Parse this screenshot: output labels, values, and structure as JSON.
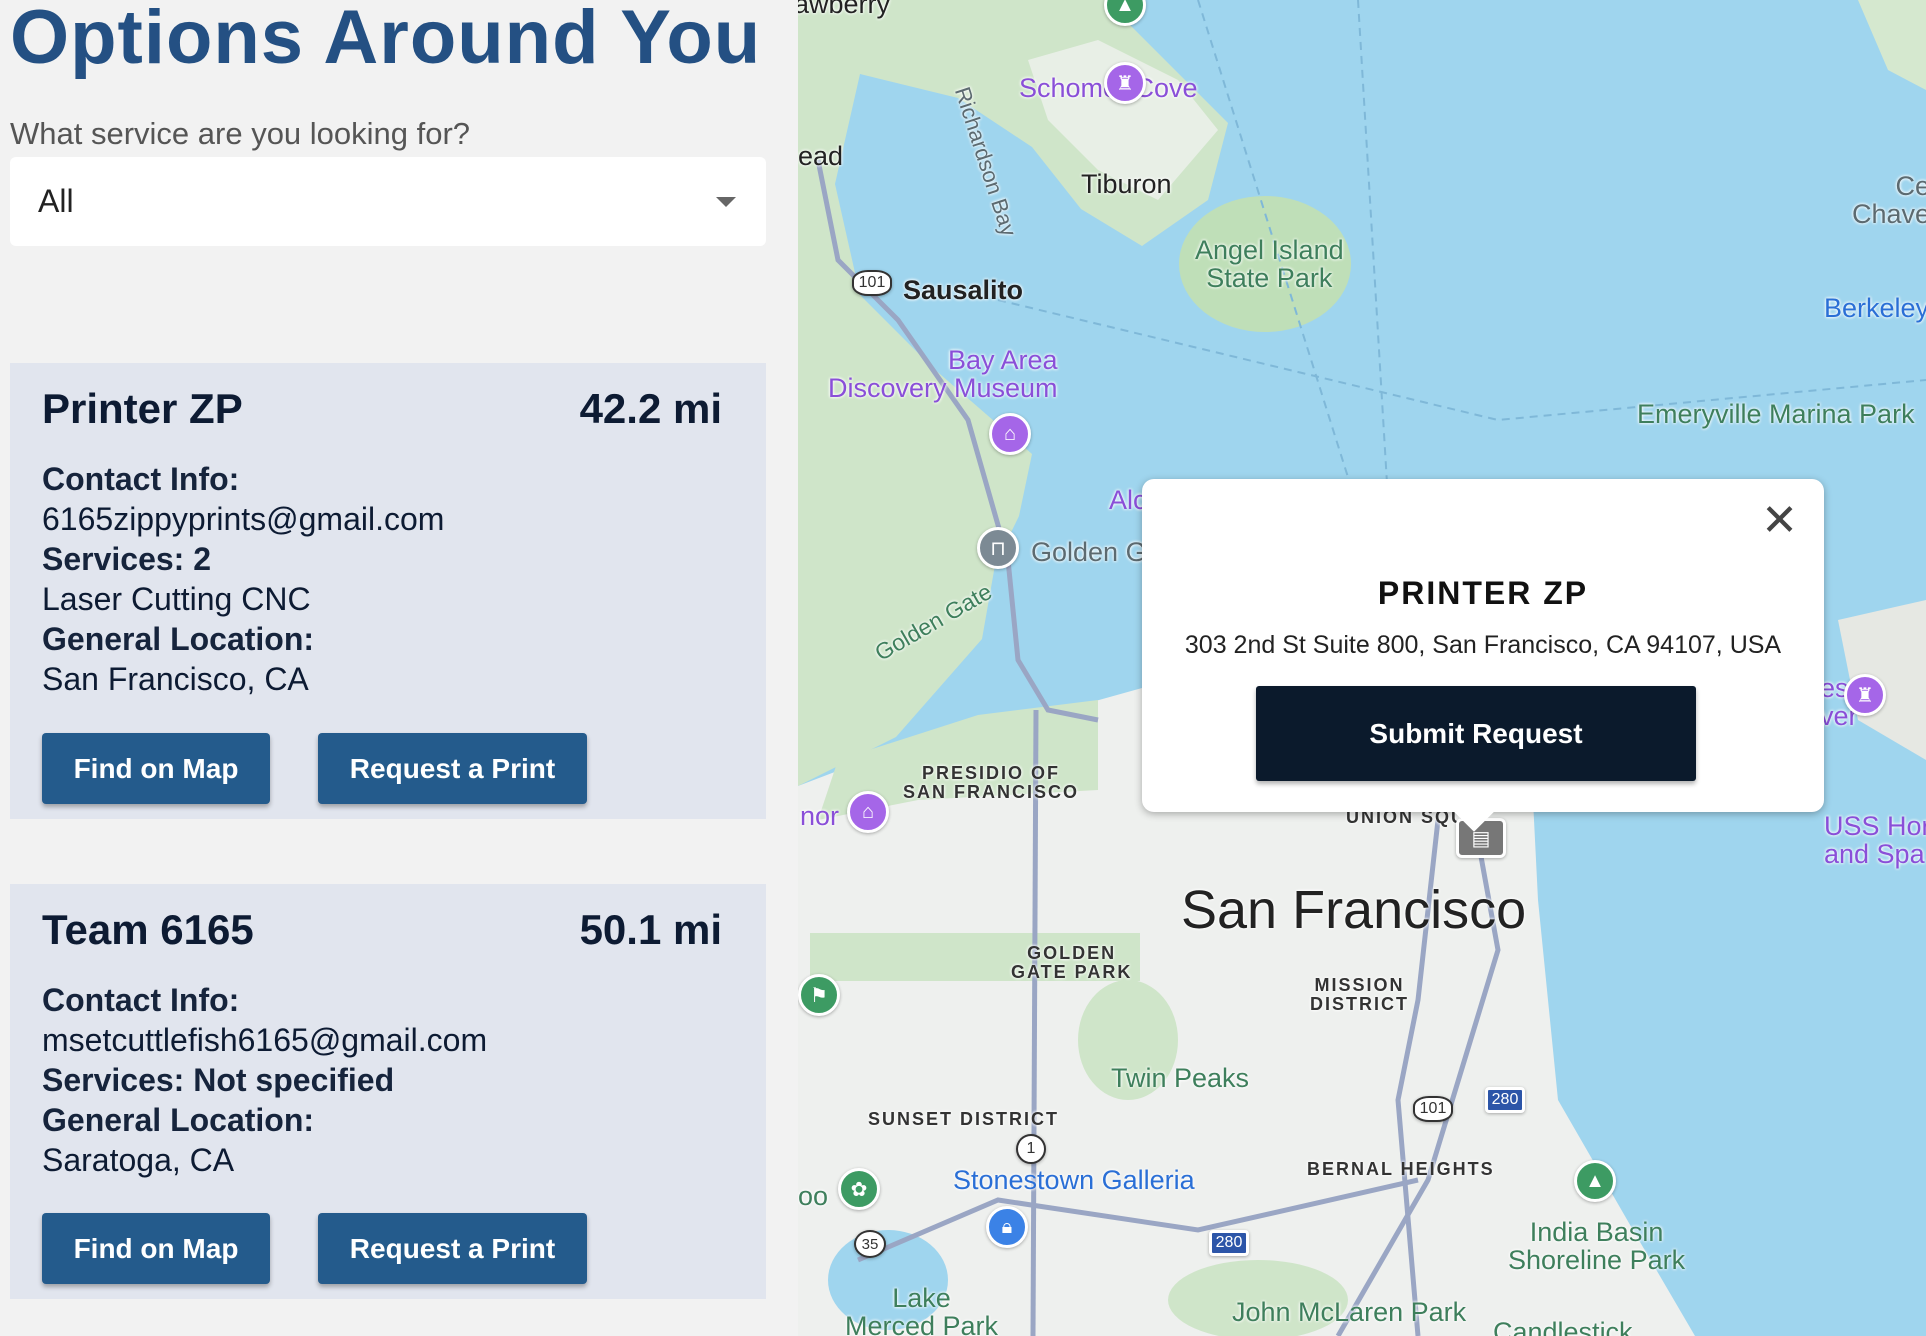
{
  "header": {
    "title": "Options Around You"
  },
  "filter": {
    "label": "What service are you looking for?",
    "selected": "All"
  },
  "cards": [
    {
      "name": "Printer ZP",
      "distance": "42.2 mi",
      "contact_label": "Contact Info:",
      "contact": "6165zippyprints@gmail.com",
      "services_label": "Services: 2",
      "services": "Laser Cutting CNC",
      "location_label": "General Location:",
      "location": "San Francisco, CA",
      "find_label": "Find on Map",
      "request_label": "Request a Print"
    },
    {
      "name": "Team 6165",
      "distance": "50.1 mi",
      "contact_label": "Contact Info:",
      "contact": "msetcuttlefish6165@gmail.com",
      "services_label": "Services: Not specified",
      "location_label": "General Location:",
      "location": "Saratoga, CA",
      "find_label": "Find on Map",
      "request_label": "Request a Print"
    }
  ],
  "popup": {
    "title": "PRINTER ZP",
    "address": "303 2nd St Suite 800, San Francisco, CA 94107, USA",
    "button": "Submit Request",
    "close_icon": "close-icon"
  },
  "map": {
    "labels": {
      "strawberry": "awberry",
      "schomer": "Schomer Cove",
      "tiburon": "Tiburon",
      "richardson": "Richardson Bay",
      "belvedere": "ead",
      "sausalito": "Sausalito",
      "angel1": "Angel Island",
      "angel2": "State Park",
      "cerrito1": "Ce",
      "cerrito2": "Chave",
      "berkeley": "Berkeley",
      "emeryville": "Emeryville Marina Park",
      "bay1": "Bay Area",
      "bay2": "Discovery Museum",
      "alc": "Alc",
      "goldeng": "Golden G",
      "goldengate": "Golden Gate",
      "presidio1": "PRESIDIO OF",
      "presidio2": "SAN FRANCISCO",
      "nor": "nor",
      "yes1": "es",
      "yes2": "ver",
      "uss1": "USS Hor",
      "uss2": "and Spa",
      "union": "UNION SQUA",
      "sf": "San Francisco",
      "ggp1": "GOLDEN",
      "ggp2": "GATE PARK",
      "mission1": "MISSION",
      "mission2": "DISTRICT",
      "twin": "Twin Peaks",
      "sunset": "SUNSET DISTRICT",
      "stonestown": "Stonestown Galleria",
      "bernal": "BERNAL HEIGHTS",
      "india1": "India Basin",
      "india2": "Shoreline Park",
      "oo": "oo",
      "lake1": "Lake",
      "lake2": "Merced Park",
      "mclaren": "John McLaren Park",
      "candlestick": "Candlestick"
    },
    "shields": {
      "h101a": "101",
      "h101b": "101",
      "h280a": "280",
      "h280b": "280",
      "h1": "1",
      "h35": "35"
    }
  },
  "colors": {
    "title": "#245083",
    "button": "#245b8c",
    "popup_button": "#0b1a2c",
    "water": "#9fd5ee",
    "land": "#eef0ee"
  }
}
